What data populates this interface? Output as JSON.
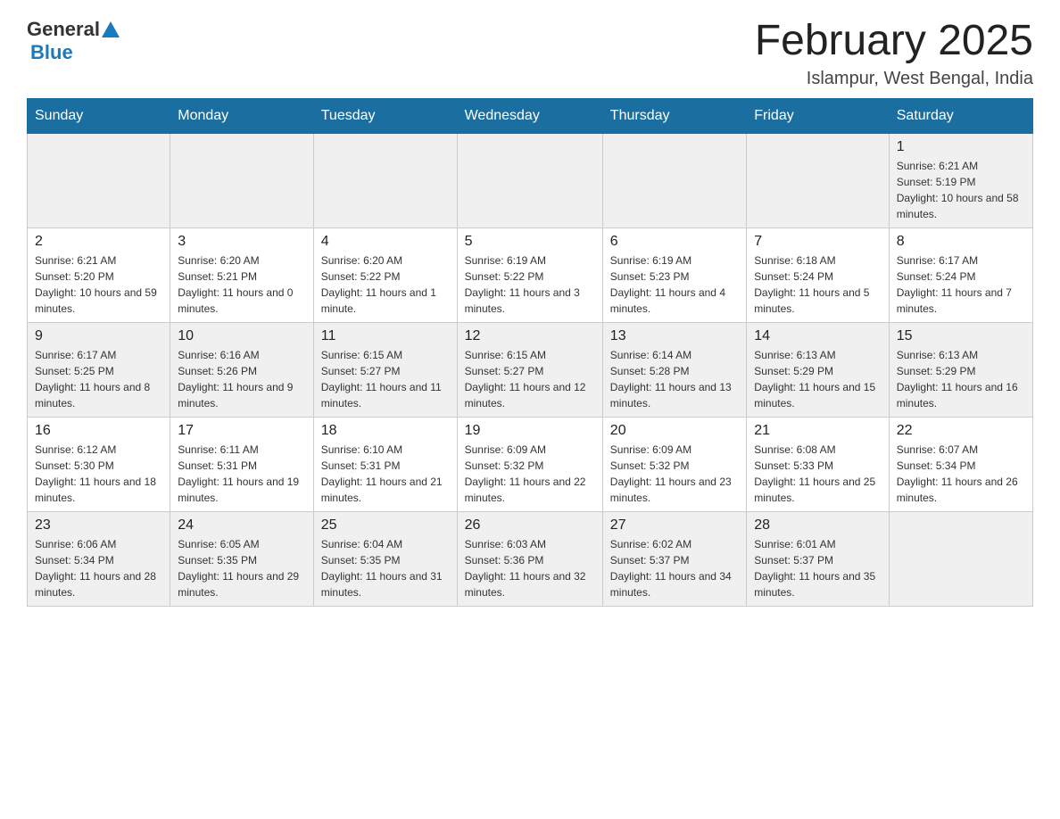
{
  "header": {
    "logo_general": "General",
    "logo_blue": "Blue",
    "month_title": "February 2025",
    "location": "Islampur, West Bengal, India"
  },
  "weekdays": [
    "Sunday",
    "Monday",
    "Tuesday",
    "Wednesday",
    "Thursday",
    "Friday",
    "Saturday"
  ],
  "weeks": [
    {
      "days": [
        {
          "number": "",
          "sunrise": "",
          "sunset": "",
          "daylight": ""
        },
        {
          "number": "",
          "sunrise": "",
          "sunset": "",
          "daylight": ""
        },
        {
          "number": "",
          "sunrise": "",
          "sunset": "",
          "daylight": ""
        },
        {
          "number": "",
          "sunrise": "",
          "sunset": "",
          "daylight": ""
        },
        {
          "number": "",
          "sunrise": "",
          "sunset": "",
          "daylight": ""
        },
        {
          "number": "",
          "sunrise": "",
          "sunset": "",
          "daylight": ""
        },
        {
          "number": "1",
          "sunrise": "Sunrise: 6:21 AM",
          "sunset": "Sunset: 5:19 PM",
          "daylight": "Daylight: 10 hours and 58 minutes."
        }
      ]
    },
    {
      "days": [
        {
          "number": "2",
          "sunrise": "Sunrise: 6:21 AM",
          "sunset": "Sunset: 5:20 PM",
          "daylight": "Daylight: 10 hours and 59 minutes."
        },
        {
          "number": "3",
          "sunrise": "Sunrise: 6:20 AM",
          "sunset": "Sunset: 5:21 PM",
          "daylight": "Daylight: 11 hours and 0 minutes."
        },
        {
          "number": "4",
          "sunrise": "Sunrise: 6:20 AM",
          "sunset": "Sunset: 5:22 PM",
          "daylight": "Daylight: 11 hours and 1 minute."
        },
        {
          "number": "5",
          "sunrise": "Sunrise: 6:19 AM",
          "sunset": "Sunset: 5:22 PM",
          "daylight": "Daylight: 11 hours and 3 minutes."
        },
        {
          "number": "6",
          "sunrise": "Sunrise: 6:19 AM",
          "sunset": "Sunset: 5:23 PM",
          "daylight": "Daylight: 11 hours and 4 minutes."
        },
        {
          "number": "7",
          "sunrise": "Sunrise: 6:18 AM",
          "sunset": "Sunset: 5:24 PM",
          "daylight": "Daylight: 11 hours and 5 minutes."
        },
        {
          "number": "8",
          "sunrise": "Sunrise: 6:17 AM",
          "sunset": "Sunset: 5:24 PM",
          "daylight": "Daylight: 11 hours and 7 minutes."
        }
      ]
    },
    {
      "days": [
        {
          "number": "9",
          "sunrise": "Sunrise: 6:17 AM",
          "sunset": "Sunset: 5:25 PM",
          "daylight": "Daylight: 11 hours and 8 minutes."
        },
        {
          "number": "10",
          "sunrise": "Sunrise: 6:16 AM",
          "sunset": "Sunset: 5:26 PM",
          "daylight": "Daylight: 11 hours and 9 minutes."
        },
        {
          "number": "11",
          "sunrise": "Sunrise: 6:15 AM",
          "sunset": "Sunset: 5:27 PM",
          "daylight": "Daylight: 11 hours and 11 minutes."
        },
        {
          "number": "12",
          "sunrise": "Sunrise: 6:15 AM",
          "sunset": "Sunset: 5:27 PM",
          "daylight": "Daylight: 11 hours and 12 minutes."
        },
        {
          "number": "13",
          "sunrise": "Sunrise: 6:14 AM",
          "sunset": "Sunset: 5:28 PM",
          "daylight": "Daylight: 11 hours and 13 minutes."
        },
        {
          "number": "14",
          "sunrise": "Sunrise: 6:13 AM",
          "sunset": "Sunset: 5:29 PM",
          "daylight": "Daylight: 11 hours and 15 minutes."
        },
        {
          "number": "15",
          "sunrise": "Sunrise: 6:13 AM",
          "sunset": "Sunset: 5:29 PM",
          "daylight": "Daylight: 11 hours and 16 minutes."
        }
      ]
    },
    {
      "days": [
        {
          "number": "16",
          "sunrise": "Sunrise: 6:12 AM",
          "sunset": "Sunset: 5:30 PM",
          "daylight": "Daylight: 11 hours and 18 minutes."
        },
        {
          "number": "17",
          "sunrise": "Sunrise: 6:11 AM",
          "sunset": "Sunset: 5:31 PM",
          "daylight": "Daylight: 11 hours and 19 minutes."
        },
        {
          "number": "18",
          "sunrise": "Sunrise: 6:10 AM",
          "sunset": "Sunset: 5:31 PM",
          "daylight": "Daylight: 11 hours and 21 minutes."
        },
        {
          "number": "19",
          "sunrise": "Sunrise: 6:09 AM",
          "sunset": "Sunset: 5:32 PM",
          "daylight": "Daylight: 11 hours and 22 minutes."
        },
        {
          "number": "20",
          "sunrise": "Sunrise: 6:09 AM",
          "sunset": "Sunset: 5:32 PM",
          "daylight": "Daylight: 11 hours and 23 minutes."
        },
        {
          "number": "21",
          "sunrise": "Sunrise: 6:08 AM",
          "sunset": "Sunset: 5:33 PM",
          "daylight": "Daylight: 11 hours and 25 minutes."
        },
        {
          "number": "22",
          "sunrise": "Sunrise: 6:07 AM",
          "sunset": "Sunset: 5:34 PM",
          "daylight": "Daylight: 11 hours and 26 minutes."
        }
      ]
    },
    {
      "days": [
        {
          "number": "23",
          "sunrise": "Sunrise: 6:06 AM",
          "sunset": "Sunset: 5:34 PM",
          "daylight": "Daylight: 11 hours and 28 minutes."
        },
        {
          "number": "24",
          "sunrise": "Sunrise: 6:05 AM",
          "sunset": "Sunset: 5:35 PM",
          "daylight": "Daylight: 11 hours and 29 minutes."
        },
        {
          "number": "25",
          "sunrise": "Sunrise: 6:04 AM",
          "sunset": "Sunset: 5:35 PM",
          "daylight": "Daylight: 11 hours and 31 minutes."
        },
        {
          "number": "26",
          "sunrise": "Sunrise: 6:03 AM",
          "sunset": "Sunset: 5:36 PM",
          "daylight": "Daylight: 11 hours and 32 minutes."
        },
        {
          "number": "27",
          "sunrise": "Sunrise: 6:02 AM",
          "sunset": "Sunset: 5:37 PM",
          "daylight": "Daylight: 11 hours and 34 minutes."
        },
        {
          "number": "28",
          "sunrise": "Sunrise: 6:01 AM",
          "sunset": "Sunset: 5:37 PM",
          "daylight": "Daylight: 11 hours and 35 minutes."
        },
        {
          "number": "",
          "sunrise": "",
          "sunset": "",
          "daylight": ""
        }
      ]
    }
  ]
}
